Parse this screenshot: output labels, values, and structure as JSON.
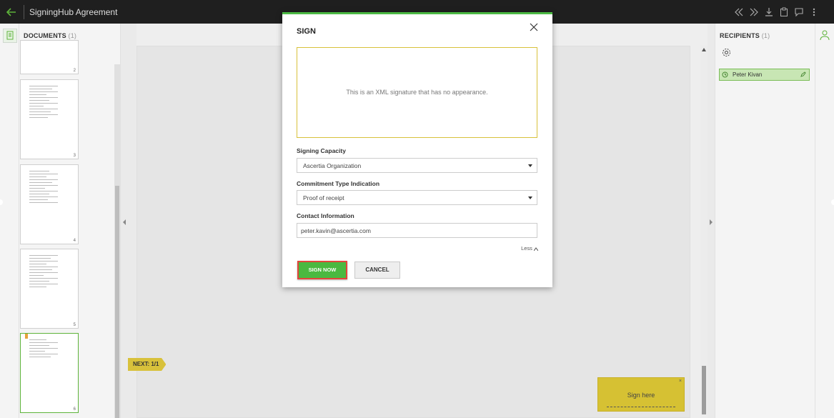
{
  "app": {
    "title": "SigningHub Agreement"
  },
  "topbar": {
    "icons": [
      "double-chevron-left-icon",
      "double-chevron-right-icon",
      "download-icon",
      "clipboard-icon",
      "comment-icon",
      "more-vertical-icon"
    ]
  },
  "documents_panel": {
    "title": "DOCUMENTS",
    "count": "(1)",
    "pages": [
      {
        "num": "2"
      },
      {
        "num": "3"
      },
      {
        "num": "4"
      },
      {
        "num": "5"
      },
      {
        "num": "6"
      }
    ]
  },
  "viewer": {
    "next_tag": "NEXT: 1/1",
    "sign_here_label": "Sign here",
    "sign_here_close": "×"
  },
  "recipients_panel": {
    "title": "RECIPIENTS",
    "count": "(1)",
    "recipient_name": "Peter Kivan"
  },
  "modal": {
    "title": "SIGN",
    "signature_message": "This is an XML signature that has no appearance.",
    "signing_capacity_label": "Signing Capacity",
    "signing_capacity_value": "Ascertia Organization",
    "commitment_label": "Commitment Type Indication",
    "commitment_value": "Proof of receipt",
    "contact_label": "Contact Information",
    "contact_value": "peter.kavin@ascertia.com",
    "less_label": "Less",
    "sign_now_label": "SIGN NOW",
    "cancel_label": "CANCEL"
  },
  "colors": {
    "accent_green": "#4cb944",
    "highlight_red": "#e2453b",
    "sign_field_yellow": "#d6c133",
    "topbar_bg": "#1f1f1f"
  }
}
